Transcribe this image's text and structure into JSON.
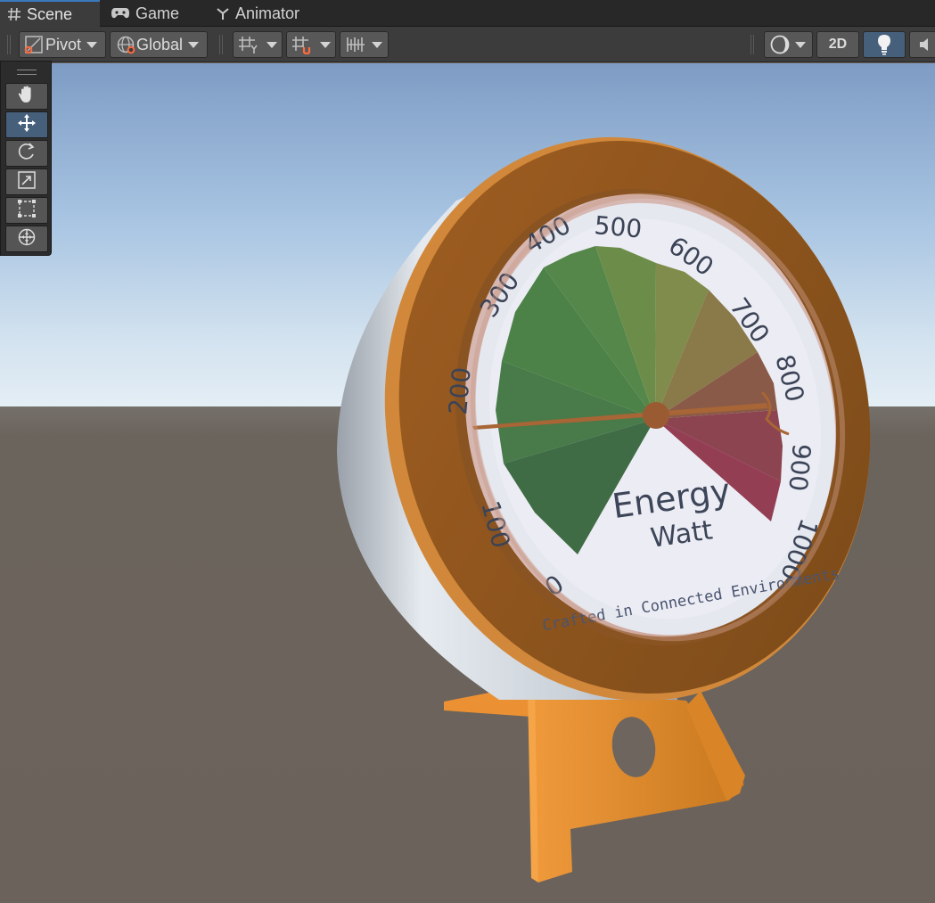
{
  "tabs": [
    {
      "label": "Scene",
      "icon": "hash-grid-icon",
      "active": true
    },
    {
      "label": "Game",
      "icon": "gamepad-icon",
      "active": false
    },
    {
      "label": "Animator",
      "icon": "animator-icon",
      "active": false
    }
  ],
  "toolbar": {
    "pivot_label": "Pivot",
    "global_label": "Global",
    "mode_2d_label": "2D",
    "lighting_on": true
  },
  "tools": [
    {
      "name": "view-tool",
      "icon": "hand-icon",
      "active": false
    },
    {
      "name": "move-tool",
      "icon": "move-arrows-icon",
      "active": true
    },
    {
      "name": "rotate-tool",
      "icon": "rotate-icon",
      "active": false
    },
    {
      "name": "scale-tool",
      "icon": "scale-icon",
      "active": false
    },
    {
      "name": "rect-tool",
      "icon": "rect-transform-icon",
      "active": false
    },
    {
      "name": "transform-tool",
      "icon": "transform-icon",
      "active": false
    }
  ],
  "gauge": {
    "title": "Energy",
    "unit": "Watt",
    "brand": "Crafted in Connected Environments",
    "ticks": [
      "0",
      "100",
      "200",
      "300",
      "400",
      "500",
      "600",
      "700",
      "800",
      "900",
      "1000"
    ],
    "needle_value": 200
  },
  "colors": {
    "accent": "#3a79bb",
    "active_button": "#46607c",
    "gauge_frame": "#c07a2e",
    "gauge_stand": "#e08a30"
  }
}
